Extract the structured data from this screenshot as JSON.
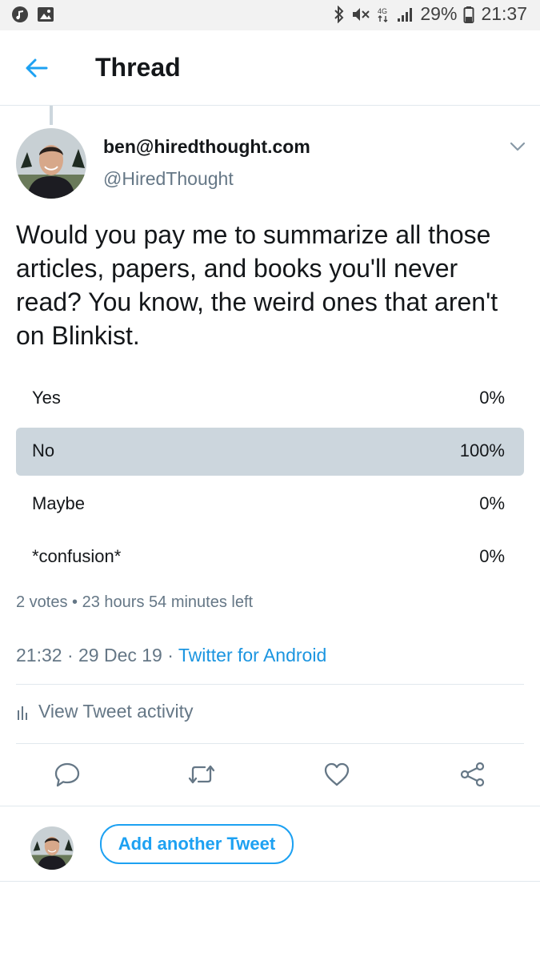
{
  "status_bar": {
    "battery": "29%",
    "time": "21:37"
  },
  "header": {
    "title": "Thread"
  },
  "tweet": {
    "display_name": "ben@hiredthought.com",
    "handle": "@HiredThought",
    "text": "Would you pay me to summarize all those articles, papers, and books you'll never read? You know, the weird ones that aren't on Blinkist.",
    "poll": {
      "options": [
        {
          "label": "Yes",
          "percent": "0%",
          "fraction": 0
        },
        {
          "label": "No",
          "percent": "100%",
          "fraction": 1
        },
        {
          "label": "Maybe",
          "percent": "0%",
          "fraction": 0
        },
        {
          "label": "*confusion*",
          "percent": "0%",
          "fraction": 0
        }
      ],
      "votes": "2 votes",
      "time_left": "23 hours 54 minutes left",
      "separator": "•"
    },
    "timestamp": "21:32 · 29 Dec 19 · ",
    "source": "Twitter for Android"
  },
  "activity": {
    "label": "View Tweet activity"
  },
  "actions": [
    "reply-icon",
    "retweet-icon",
    "like-icon",
    "share-icon"
  ],
  "reply_bar": {
    "button_label": "Add another Tweet"
  },
  "colors": {
    "accent": "#1da1f2",
    "bar": "#ccd6dd",
    "secondary_text": "#657786"
  }
}
